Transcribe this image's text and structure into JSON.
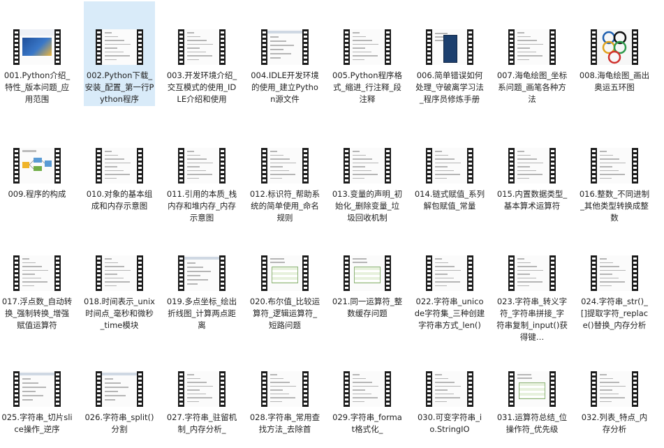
{
  "window": {
    "title": ""
  },
  "selected_index": 1,
  "items": [
    {
      "label": "001.Python介绍_特性_版本问题_应用范围",
      "thumb": "banner",
      "icon": "video-thumbnail-icon"
    },
    {
      "label": "002.Python下载_安装_配置_第一行Python程序",
      "thumb": "doc",
      "icon": "video-thumbnail-icon"
    },
    {
      "label": "003.开发环境介绍_交互模式的使用_IDLE介绍和使用",
      "thumb": "doc",
      "icon": "video-thumbnail-icon"
    },
    {
      "label": "004.IDLE开发环境的使用_建立Python源文件",
      "thumb": "window",
      "icon": "video-thumbnail-icon"
    },
    {
      "label": "005.Python程序格式_缩进_行注释_段注释",
      "thumb": "doc",
      "icon": "video-thumbnail-icon"
    },
    {
      "label": "006.简单错误如何处理_守破离学习法_程序员修炼手册",
      "thumb": "book",
      "icon": "video-thumbnail-icon"
    },
    {
      "label": "007.海龟绘图_坐标系问题_画笔各种方法",
      "thumb": "doc",
      "icon": "video-thumbnail-icon"
    },
    {
      "label": "008.海龟绘图_画出奥运五环图",
      "thumb": "rings",
      "icon": "video-thumbnail-icon"
    },
    {
      "label": "009.程序的构成",
      "thumb": "diagram",
      "icon": "video-thumbnail-icon"
    },
    {
      "label": "010.对象的基本组成和内存示意图",
      "thumb": "doc",
      "icon": "video-thumbnail-icon"
    },
    {
      "label": "011.引用的本质_栈内存和堆内存_内存示意图",
      "thumb": "doc",
      "icon": "video-thumbnail-icon"
    },
    {
      "label": "012.标识符_帮助系统的简单使用_命名规则",
      "thumb": "doc",
      "icon": "video-thumbnail-icon"
    },
    {
      "label": "013.变量的声明_初始化_删除变量_垃圾回收机制",
      "thumb": "doc",
      "icon": "video-thumbnail-icon"
    },
    {
      "label": "014.链式赋值_系列解包赋值_常量",
      "thumb": "doc",
      "icon": "video-thumbnail-icon"
    },
    {
      "label": "015.内置数据类型_基本算术运算符",
      "thumb": "doc",
      "icon": "video-thumbnail-icon"
    },
    {
      "label": "016.整数_不同进制_其他类型转换成整数",
      "thumb": "doc",
      "icon": "video-thumbnail-icon"
    },
    {
      "label": "017.浮点数_自动转换_强制转换_增强赋值运算符",
      "thumb": "doc",
      "icon": "video-thumbnail-icon"
    },
    {
      "label": "018.时间表示_unix时间点_毫秒和微秒_time模块",
      "thumb": "doc",
      "icon": "video-thumbnail-icon"
    },
    {
      "label": "019.多点坐标_绘出折线图_计算两点距离",
      "thumb": "window",
      "icon": "video-thumbnail-icon"
    },
    {
      "label": "020.布尔值_比较运算符_逻辑运算符_短路问题",
      "thumb": "table",
      "icon": "video-thumbnail-icon"
    },
    {
      "label": "021.同一运算符_整数缓存问题",
      "thumb": "table",
      "icon": "video-thumbnail-icon"
    },
    {
      "label": "022.字符串_unicode字符集_三种创建字符串方式_len()",
      "thumb": "doc",
      "icon": "video-thumbnail-icon"
    },
    {
      "label": "023.字符串_转义字符_字符串拼接_字符串复制_input()获得键…",
      "thumb": "doc",
      "icon": "video-thumbnail-icon"
    },
    {
      "label": "024.字符串_str()_[]提取字符_replace()替换_内存分析",
      "thumb": "doc",
      "icon": "video-thumbnail-icon"
    },
    {
      "label": "025.字符串_切片slice操作_逆序",
      "thumb": "window",
      "icon": "video-thumbnail-icon"
    },
    {
      "label": "026.字符串_split()分割",
      "thumb": "window",
      "icon": "video-thumbnail-icon"
    },
    {
      "label": "027.字符串_驻留机制_内存分析_",
      "thumb": "doc",
      "icon": "video-thumbnail-icon"
    },
    {
      "label": "028.字符串_常用查找方法_去除首",
      "thumb": "doc",
      "icon": "video-thumbnail-icon"
    },
    {
      "label": "029.字符串_format格式化_",
      "thumb": "doc",
      "icon": "video-thumbnail-icon"
    },
    {
      "label": "030.可变字符串_io.StringIO",
      "thumb": "doc",
      "icon": "video-thumbnail-icon"
    },
    {
      "label": "031.运算符总结_位操作符_优先级",
      "thumb": "table",
      "icon": "video-thumbnail-icon"
    },
    {
      "label": "032.列表_特点_内存分析",
      "thumb": "doc",
      "icon": "video-thumbnail-icon"
    }
  ]
}
